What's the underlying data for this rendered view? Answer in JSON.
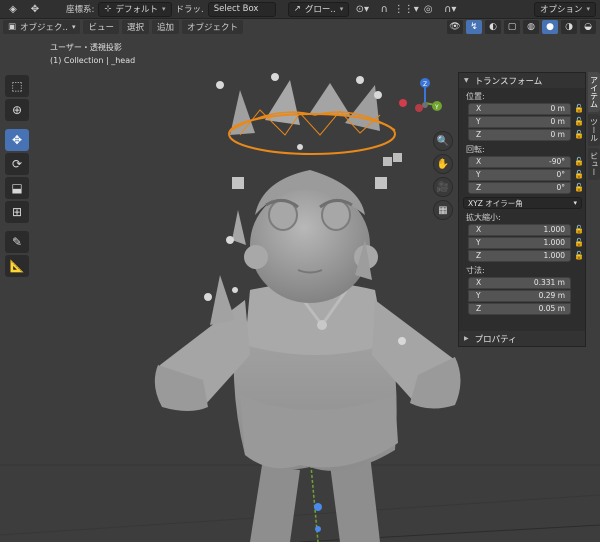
{
  "topbar": {
    "coord_label": "座標系:",
    "transform_orientation": "デフォルト",
    "drag_label": "ドラッ.",
    "select_box": "Select Box",
    "pivot": "グロー..",
    "option_label": "オプション"
  },
  "header2": {
    "mode": "オブジェク..",
    "menus": [
      "ビュー",
      "選択",
      "追加",
      "オブジェクト"
    ]
  },
  "viewport": {
    "view_name": "ユーザー・透視投影",
    "collection": "(1) Collection | _head",
    "gizmo": {
      "x_axis": "X",
      "y_axis": "Y",
      "z_axis": "Z"
    }
  },
  "tools": [
    "select-box",
    "cursor",
    "move",
    "rotate",
    "scale",
    "transform",
    "annotate",
    "measure"
  ],
  "npanel": {
    "title": "トランスフォーム",
    "location_label": "位置:",
    "location": [
      {
        "axis": "X",
        "value": "0 m"
      },
      {
        "axis": "Y",
        "value": "0 m"
      },
      {
        "axis": "Z",
        "value": "0 m"
      }
    ],
    "rotation_label": "回転:",
    "rotation": [
      {
        "axis": "X",
        "value": "-90°"
      },
      {
        "axis": "Y",
        "value": "0°"
      },
      {
        "axis": "Z",
        "value": "0°"
      }
    ],
    "rotation_mode": "XYZ オイラー角",
    "scale_label": "拡大縮小:",
    "scale": [
      {
        "axis": "X",
        "value": "1.000"
      },
      {
        "axis": "Y",
        "value": "1.000"
      },
      {
        "axis": "Z",
        "value": "1.000"
      }
    ],
    "dimensions_label": "寸法:",
    "dimensions": [
      {
        "axis": "X",
        "value": "0.331 m"
      },
      {
        "axis": "Y",
        "value": "0.29 m"
      },
      {
        "axis": "Z",
        "value": "0.05 m"
      }
    ],
    "properties_label": "プロパティ"
  },
  "vtabs": [
    "アイテム",
    "ツール",
    "ビュー"
  ],
  "colors": {
    "accent": "#4772b3",
    "selection_orange": "#e8891a",
    "x_axis": "#d13d4a",
    "y_axis": "#70a42f",
    "z_axis": "#3a75d9"
  }
}
